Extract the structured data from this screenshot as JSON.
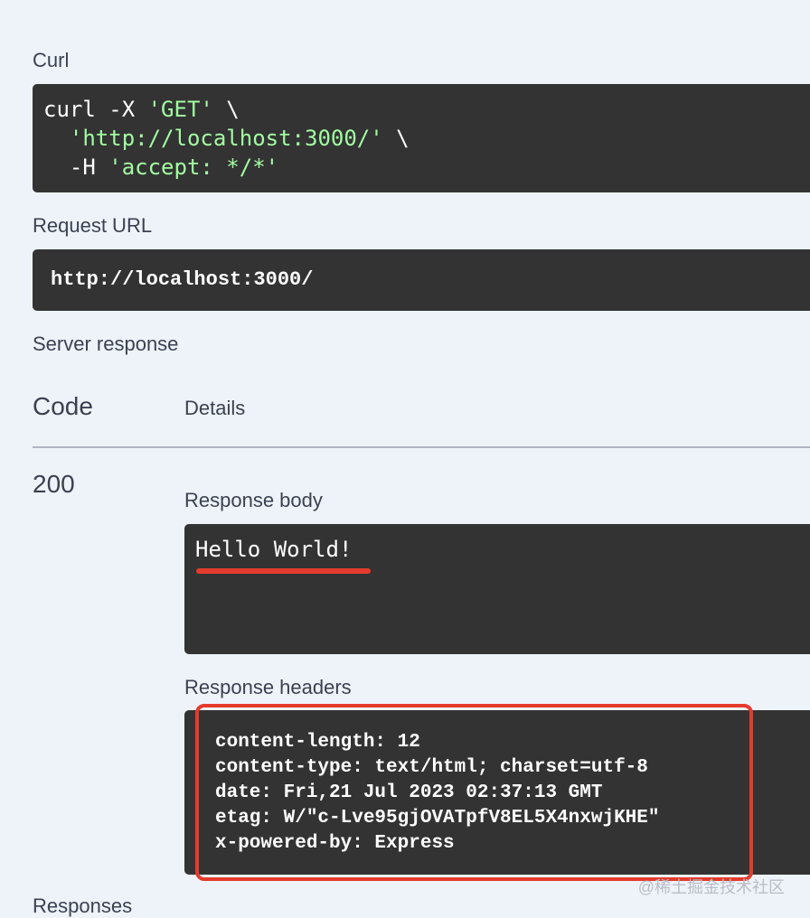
{
  "curl": {
    "label": "Curl",
    "line1_cmd": "curl -X ",
    "line1_str": "'GET'",
    "line1_tail": " \\",
    "line2_indent": "  ",
    "line2_str": "'http://localhost:3000/'",
    "line2_tail": " \\",
    "line3_cmd": "  -H ",
    "line3_str": "'accept: */*'"
  },
  "request_url": {
    "label": "Request URL",
    "value": "http://localhost:3000/"
  },
  "server_response": {
    "label": "Server response",
    "col_code": "Code",
    "col_details": "Details",
    "status_code": "200",
    "body_label": "Response body",
    "body_text": "Hello World!",
    "headers_label": "Response headers",
    "headers": [
      "content-length: 12",
      "content-type: text/html; charset=utf-8",
      "date: Fri,21 Jul 2023 02:37:13 GMT",
      "etag: W/\"c-Lve95gjOVATpfV8EL5X4nxwjKHE\"",
      "x-powered-by: Express"
    ]
  },
  "responses": {
    "label": "Responses"
  },
  "watermark": "@稀土掘金技术社区",
  "colors": {
    "background": "#eef3fa",
    "code_bg": "#333333",
    "string_green": "#a2fca2",
    "highlight_red": "#e53b2c"
  }
}
